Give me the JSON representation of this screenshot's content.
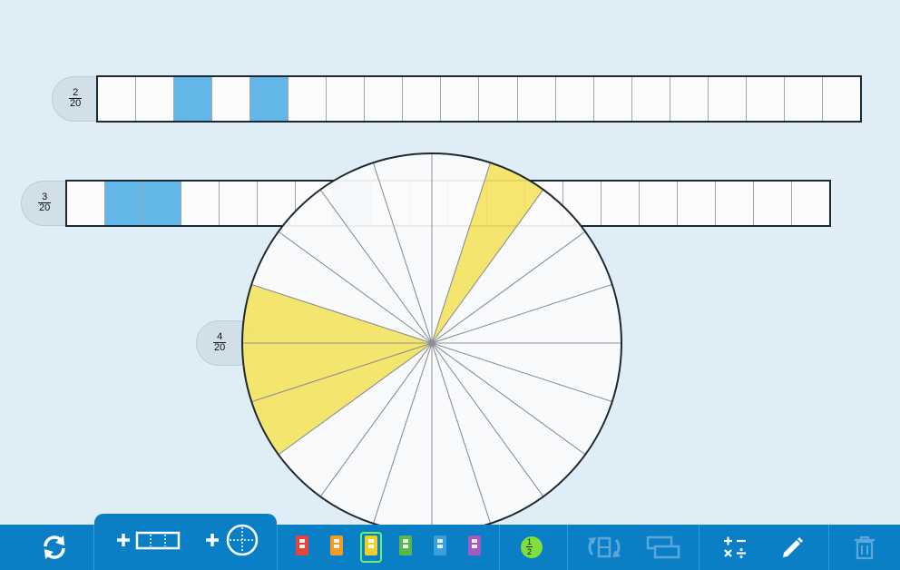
{
  "bars": [
    {
      "label_num": "2",
      "label_den": "20",
      "cells": 20,
      "filled": [
        2,
        4
      ],
      "light_filled": []
    },
    {
      "label_num": "3",
      "label_den": "20",
      "cells": 20,
      "filled": [
        1,
        2
      ],
      "light_filled": [
        7
      ]
    }
  ],
  "circle": {
    "label_num": "4",
    "label_den": "20",
    "slices": 20,
    "filled_slices": [
      1,
      13,
      14,
      15
    ]
  },
  "colors": {
    "background": "#dfeef6",
    "bar_fill": "#62b6e8",
    "circle_fill": "#f5e463",
    "toolbar": "#0b7fc6",
    "selected": "#6ef06a"
  },
  "toolbar": {
    "reset_icon": "refresh-icon",
    "add_bar_icon": "add-bar-icon",
    "add_circle_icon": "add-circle-icon",
    "color_swatches": [
      {
        "name": "red",
        "color": "#e5443a"
      },
      {
        "name": "orange",
        "color": "#f39a27"
      },
      {
        "name": "yellow",
        "color": "#f1cf2a",
        "selected": true
      },
      {
        "name": "green",
        "color": "#58b94b"
      },
      {
        "name": "blue",
        "color": "#3aa0dd"
      },
      {
        "name": "purple",
        "color": "#a45bc0"
      }
    ],
    "fraction_num": "1",
    "fraction_den": "2",
    "fraction_badge_color": "#7ee03f",
    "flip_icon": "flip-icon",
    "compare_icon": "compare-icon",
    "operations_icon": "operations-icon",
    "pencil_icon": "pencil-icon",
    "trash_icon": "trash-icon"
  }
}
